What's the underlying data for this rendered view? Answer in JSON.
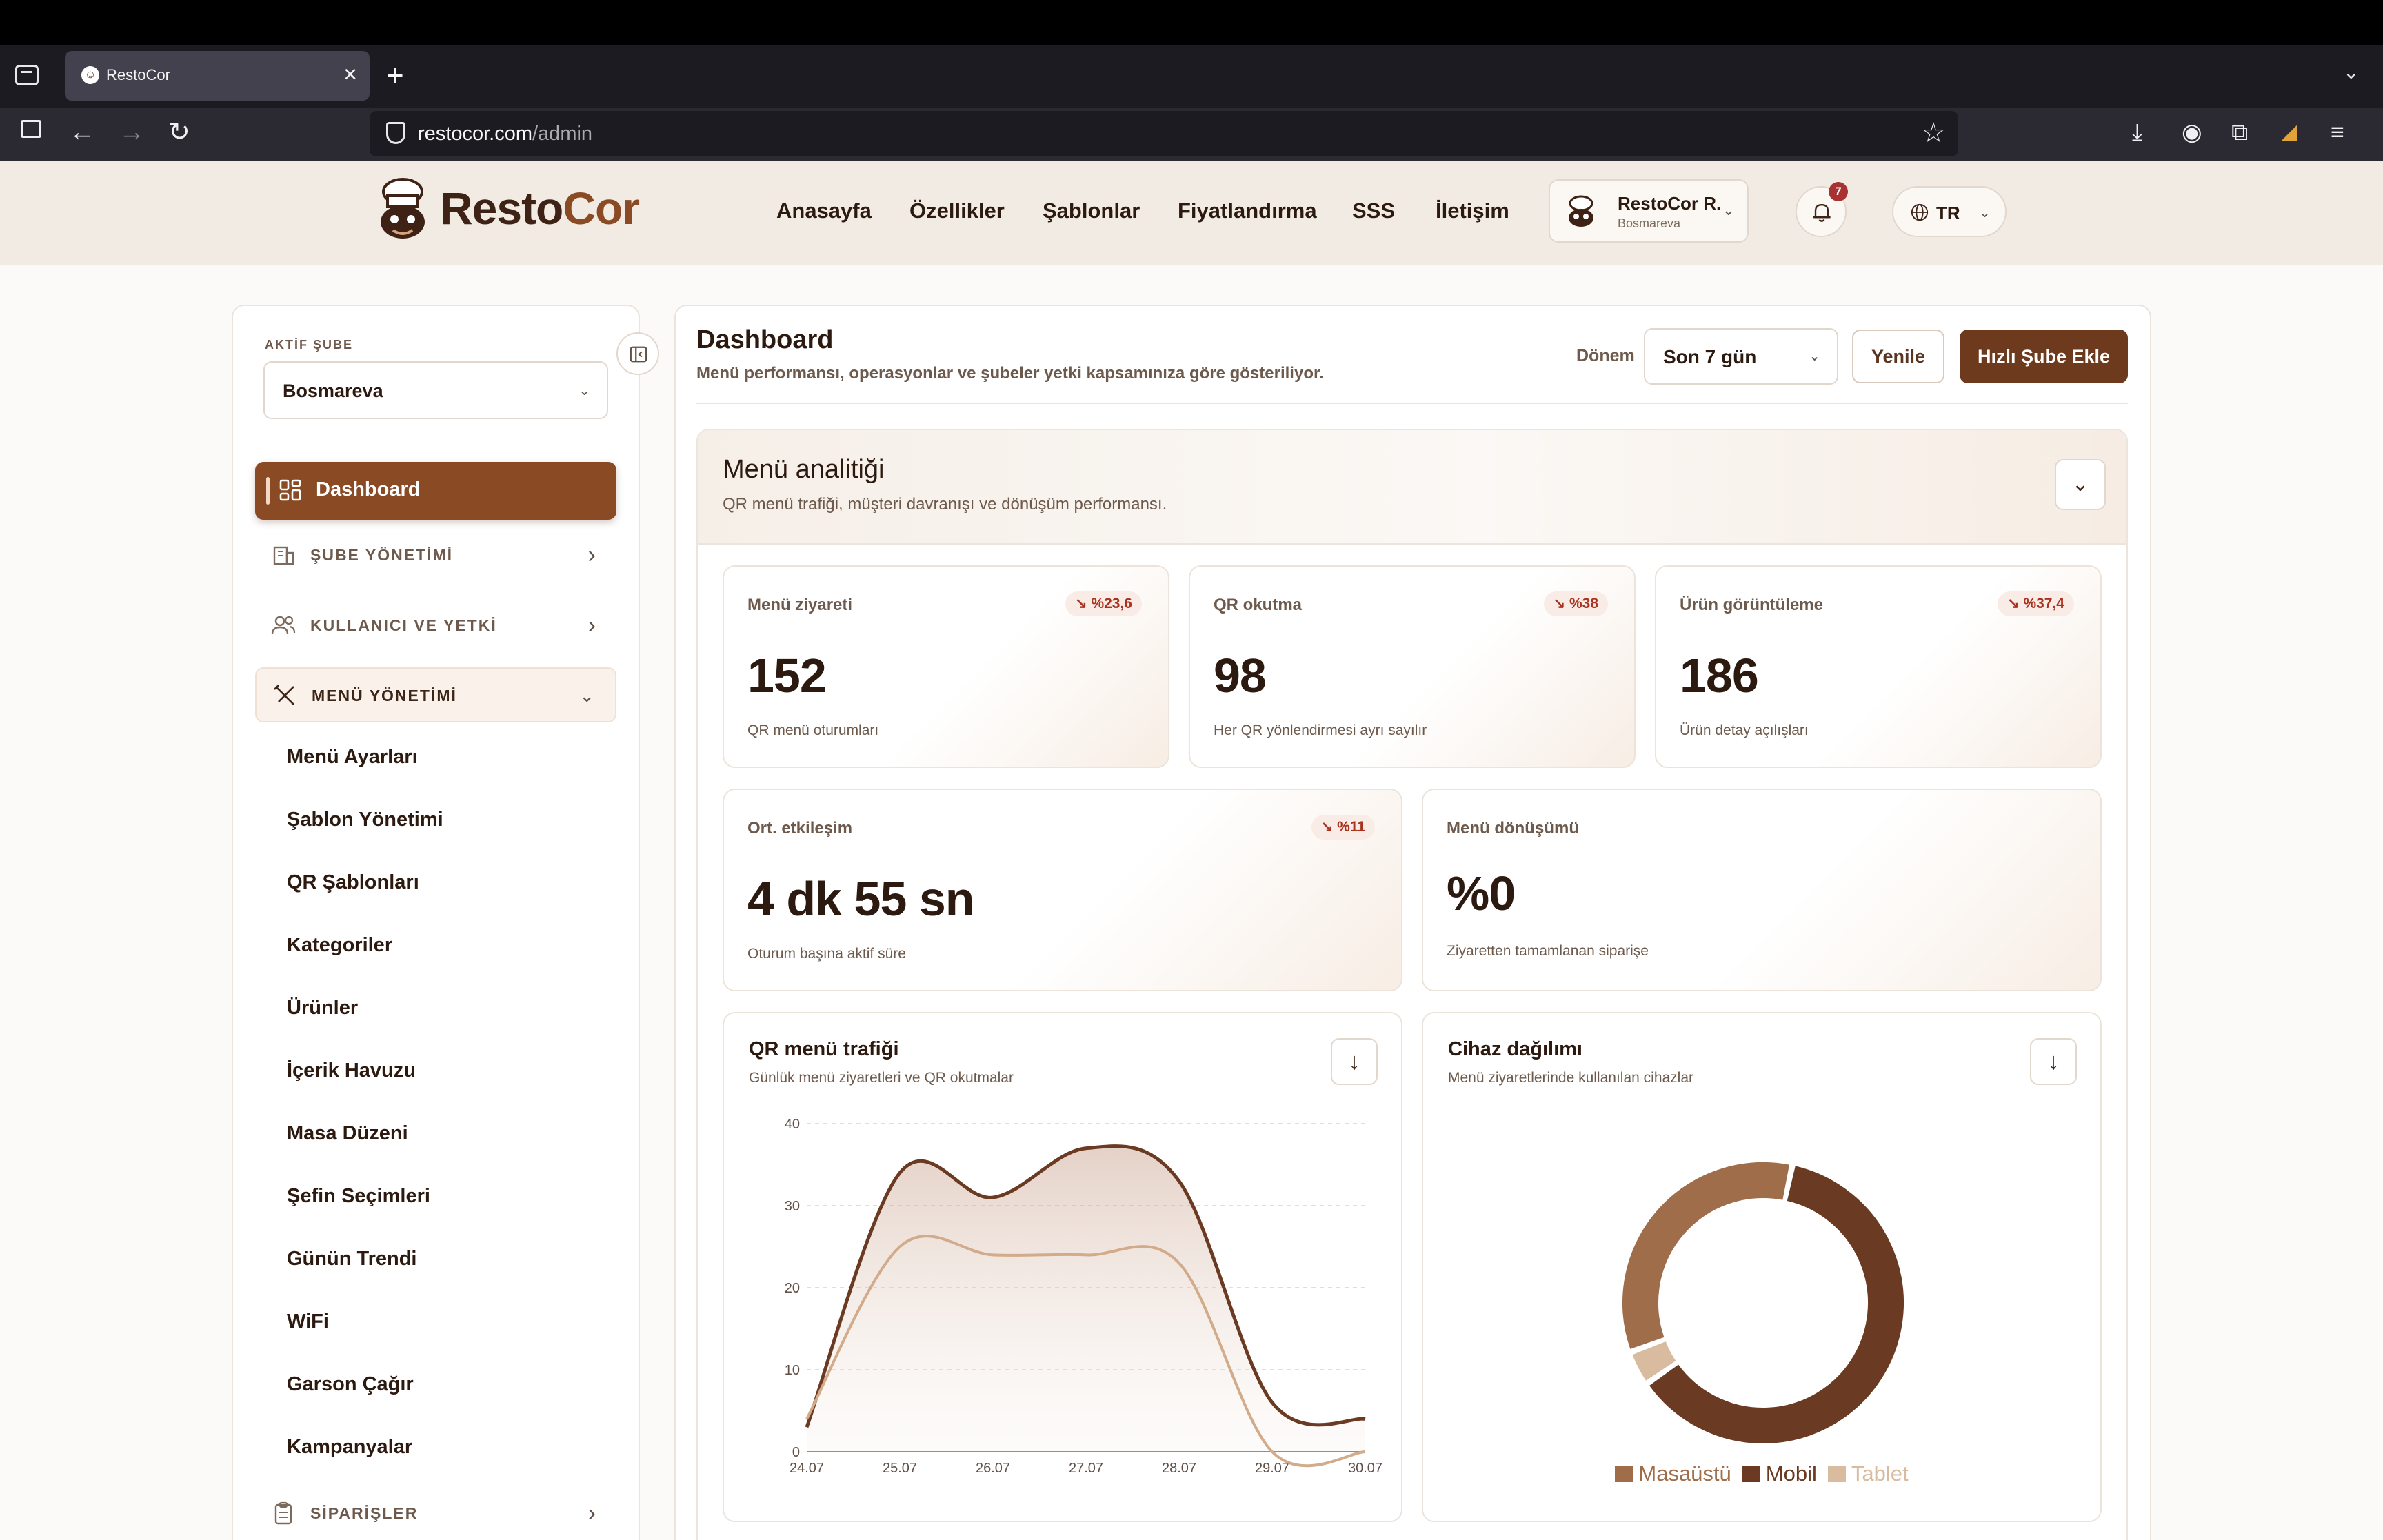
{
  "browser": {
    "tab_title": "RestoCor",
    "url_host": "restocor.com",
    "url_path": "/admin"
  },
  "header": {
    "logo_part1": "Resto",
    "logo_part2": "Cor",
    "nav": [
      "Anasayfa",
      "Özellikler",
      "Şablonlar",
      "Fiyatlandırma",
      "SSS",
      "İletişim"
    ],
    "user_name": "RestoCor R.",
    "user_branch": "Bosmareva",
    "notification_count": "7",
    "language": "TR"
  },
  "sidebar": {
    "active_branch_label": "AKTİF ŞUBE",
    "active_branch": "Bosmareva",
    "dashboard": "Dashboard",
    "groups": {
      "sube": "ŞUBE YÖNETİMİ",
      "kullanici": "KULLANICI VE YETKİ",
      "menu": "MENÜ YÖNETİMİ",
      "siparisler": "SİPARİŞLER"
    },
    "menu_items": [
      "Menü Ayarları",
      "Şablon Yönetimi",
      "QR Şablonları",
      "Kategoriler",
      "Ürünler",
      "İçerik Havuzu",
      "Masa Düzeni",
      "Şefin Seçimleri",
      "Günün Trendi",
      "WiFi",
      "Garson Çağır",
      "Kampanyalar"
    ]
  },
  "page": {
    "title": "Dashboard",
    "subtitle": "Menü performansı, operasyonlar ve şubeler yetki kapsamınıza göre gösteriliyor.",
    "period_label": "Dönem",
    "period_value": "Son 7 gün",
    "refresh_label": "Yenile",
    "add_branch_label": "Hızlı Şube Ekle"
  },
  "analytics": {
    "title": "Menü analitiği",
    "subtitle": "QR menü trafiği, müşteri davranışı ve dönüşüm performansı.",
    "kpis": [
      {
        "title": "Menü ziyareti",
        "value": "152",
        "change": "↘ %23,6",
        "foot": "QR menü oturumları"
      },
      {
        "title": "QR okutma",
        "value": "98",
        "change": "↘ %38",
        "foot": "Her QR yönlendirmesi ayrı sayılır"
      },
      {
        "title": "Ürün görüntüleme",
        "value": "186",
        "change": "↘ %37,4",
        "foot": "Ürün detay açılışları"
      },
      {
        "title": "Ort. etkileşim",
        "value": "4 dk 55 sn",
        "change": "↘ %11",
        "foot": "Oturum başına aktif süre"
      },
      {
        "title": "Menü dönüşümü",
        "value": "%0",
        "change": "",
        "foot": "Ziyaretten tamamlanan siparişe"
      }
    ],
    "traffic_title": "QR menü trafiği",
    "traffic_sub": "Günlük menü ziyaretleri ve QR okutmalar",
    "device_title": "Cihaz dağılımı",
    "device_sub": "Menü ziyaretlerinde kullanılan cihazlar"
  },
  "colors": {
    "brand": "#8a4a24",
    "brand_dark": "#6e3a1d",
    "series_visits": "#6b3a22",
    "series_scans": "#d2ab8a",
    "tablet": "#d9bc9f",
    "masaustu": "#a06d4b"
  },
  "chart_data": [
    {
      "type": "area",
      "x": [
        "24.07",
        "25.07",
        "26.07",
        "27.07",
        "28.07",
        "29.07",
        "30.07"
      ],
      "yticks": [
        0,
        10,
        20,
        30,
        40
      ],
      "ylim": [
        0,
        40
      ],
      "grid": true,
      "series": [
        {
          "values": [
            3,
            34,
            31,
            37,
            33,
            6,
            4
          ]
        },
        {
          "values": [
            4,
            25,
            24,
            24,
            23,
            0,
            0
          ]
        }
      ]
    },
    {
      "type": "pie",
      "donut": true,
      "labels": [
        "Masaüstü",
        "Mobil",
        "Tablet"
      ],
      "values": [
        34,
        62,
        4
      ],
      "legend": "bottom"
    }
  ]
}
